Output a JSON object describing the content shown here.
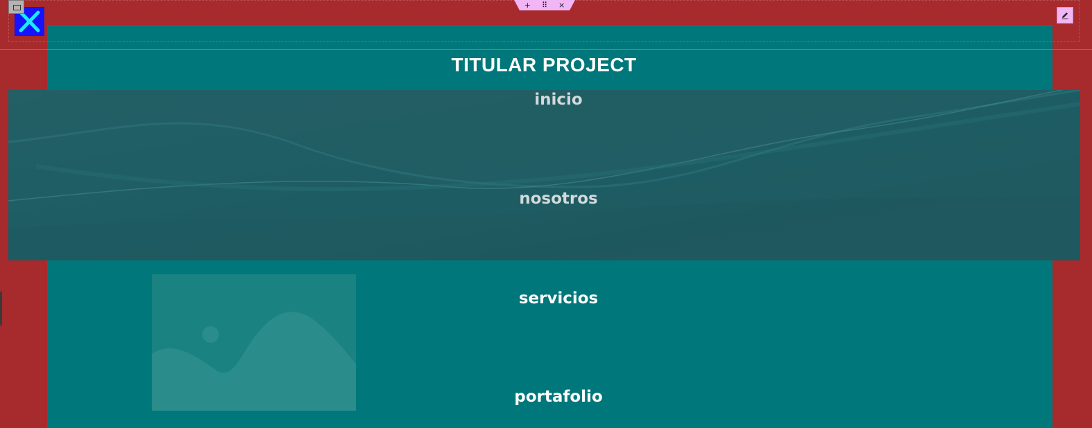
{
  "site": {
    "title": "TITULAR PROJECT"
  },
  "nav": {
    "items": [
      {
        "label": "inicio"
      },
      {
        "label": "nosotros"
      },
      {
        "label": "servicios"
      },
      {
        "label": "portafolio"
      }
    ]
  },
  "toolbar": {
    "add_icon": "+",
    "move_icon": "⠿",
    "remove_icon": "×"
  },
  "colors": {
    "page_background": "#a72a2d",
    "panel_teal": "#00777a",
    "close_button_blue": "#1414ff",
    "close_x_cyan": "#22e6ff",
    "toolbar_pink": "#f2b5f5"
  },
  "icons": {
    "close": "close-x-icon",
    "pencil": "pencil-icon",
    "placeholder": "image-placeholder-icon"
  }
}
